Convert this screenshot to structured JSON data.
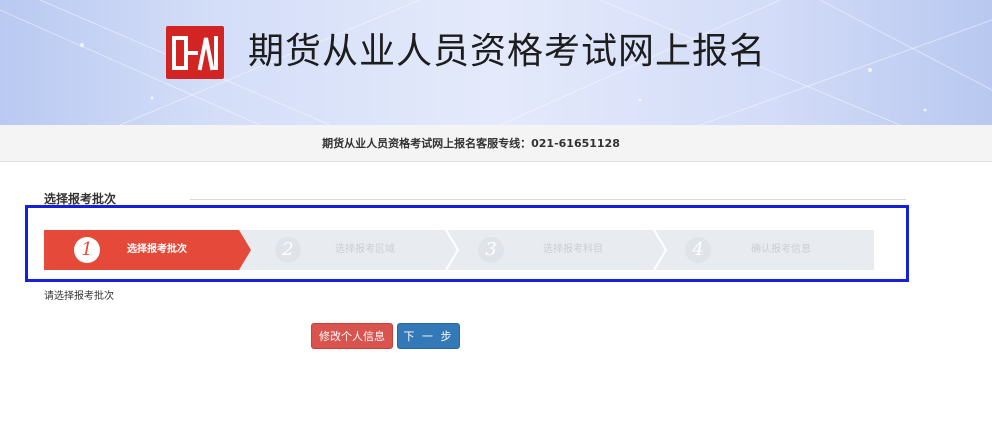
{
  "header": {
    "logo_name": "cffex-logo",
    "title": "期货从业人员资格考试网上报名"
  },
  "hotline": {
    "text": "期货从业人员资格考试网上报名客服专线：021-61651128"
  },
  "section": {
    "title": "选择报考批次"
  },
  "steps": [
    {
      "number": "1",
      "label": "选择报考批次",
      "active": true
    },
    {
      "number": "2",
      "label": "选择报考区域",
      "active": false
    },
    {
      "number": "3",
      "label": "选择报考科目",
      "active": false
    },
    {
      "number": "4",
      "label": "确认报考信息",
      "active": false
    }
  ],
  "hint": "请选择报考批次",
  "buttons": {
    "edit_label": "修改个人信息",
    "next_label": "下 一 步"
  },
  "colors": {
    "active_step": "#e5493a",
    "inactive_step": "#e8ecf0",
    "highlight_border": "#1521d6",
    "edit_button": "#d9534f",
    "next_button": "#3379b7",
    "logo": "#d32424"
  }
}
